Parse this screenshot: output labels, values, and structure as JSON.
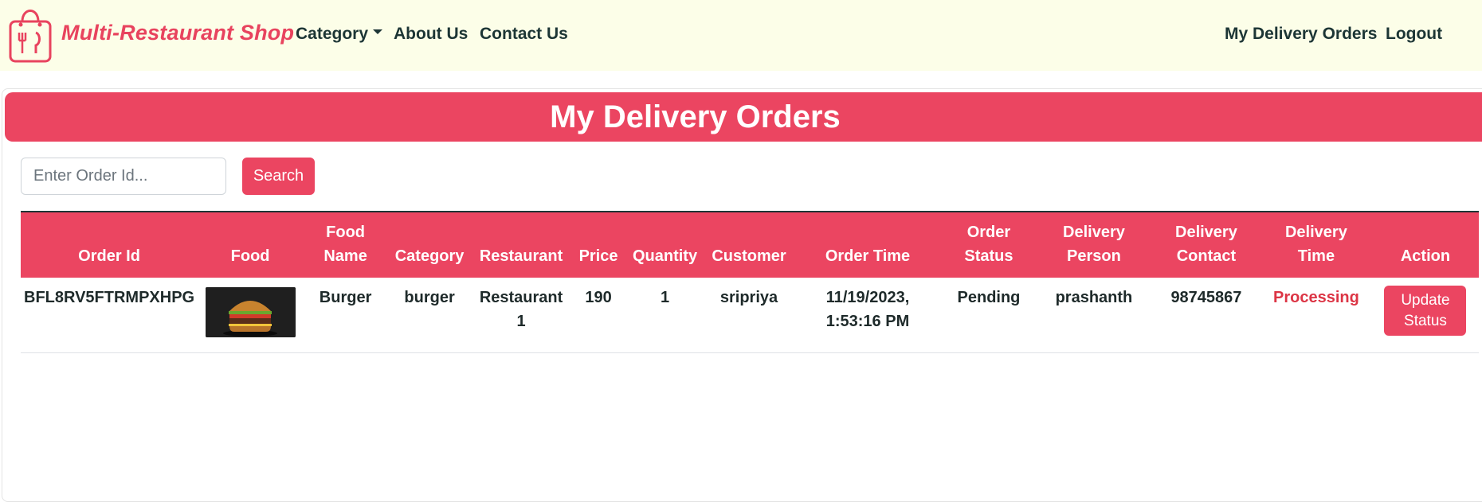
{
  "brand": {
    "name": "Multi-Restaurant Shop",
    "color": "#e8435e"
  },
  "nav": {
    "category_label": "Category",
    "about_label": "About Us",
    "contact_label": "Contact Us",
    "my_orders_label": "My Delivery Orders",
    "logout_label": "Logout"
  },
  "page": {
    "title": "My Delivery Orders",
    "search_placeholder": "Enter Order Id...",
    "search_button": "Search",
    "accent_color": "#eb4561"
  },
  "table": {
    "headers": {
      "order_id": "Order Id",
      "food": "Food",
      "food_name_1": "Food",
      "food_name_2": "Name",
      "category": "Category",
      "restaurant": "Restaurant",
      "price": "Price",
      "quantity": "Quantity",
      "customer": "Customer",
      "order_time": "Order Time",
      "order_status_1": "Order",
      "order_status_2": "Status",
      "delivery_person_1": "Delivery",
      "delivery_person_2": "Person",
      "delivery_contact_1": "Delivery",
      "delivery_contact_2": "Contact",
      "delivery_time_1": "Delivery",
      "delivery_time_2": "Time",
      "action": "Action"
    },
    "rows": [
      {
        "order_id": "BFL8RV5FTRMPXHPG",
        "food_image_icon": "burger-image",
        "food_name": "Burger",
        "category": "burger",
        "restaurant_1": "Restaurant",
        "restaurant_2": "1",
        "price": "190",
        "quantity": "1",
        "customer": "sripriya",
        "order_time_1": "11/19/2023,",
        "order_time_2": "1:53:16 PM",
        "order_status": "Pending",
        "delivery_person": "prashanth",
        "delivery_contact": "98745867",
        "delivery_time": "Processing",
        "action_1": "Update",
        "action_2": "Status"
      }
    ]
  }
}
